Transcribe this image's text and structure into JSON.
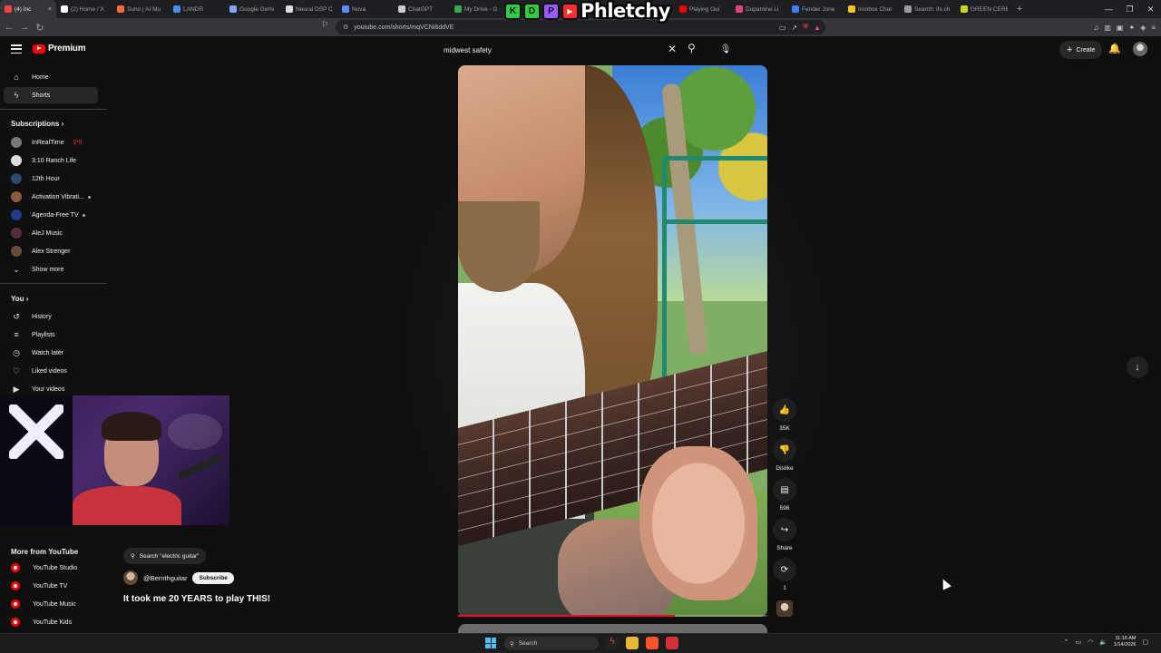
{
  "browser": {
    "tabs": [
      {
        "label": "(4) Inc",
        "color": "#ff4444",
        "active": true
      },
      {
        "label": "(2) Home / X",
        "color": "#ffffff"
      },
      {
        "label": "Suno | AI Mu",
        "color": "#ff6b3d"
      },
      {
        "label": "LANDR",
        "color": "#4a90e2"
      },
      {
        "label": "Google Gemi",
        "color": "#7aa7ff"
      },
      {
        "label": "Neural DSP C",
        "color": "#dddddd"
      },
      {
        "label": "Nova",
        "color": "#5b8cff"
      },
      {
        "label": "ChatGPT",
        "color": "#cccccc"
      },
      {
        "label": "My Drive - G",
        "color": "#34a853"
      },
      {
        "label": "",
        "color": "#34a853"
      },
      {
        "label": "",
        "color": "#999999"
      },
      {
        "label": "Boney (BETH",
        "color": "#dddddd"
      },
      {
        "label": "Playing Gui",
        "color": "#ff0000"
      },
      {
        "label": "Dopamine Li",
        "color": "#e0457b"
      },
      {
        "label": "Fender Jone",
        "color": "#3b82f6"
      },
      {
        "label": "Ironbox Char",
        "color": "#f5c518"
      },
      {
        "label": "Search: ifs ch",
        "color": "#999999"
      },
      {
        "label": "GREEN CERE",
        "color": "#c9d91a"
      }
    ],
    "close_tab_glyph": "×",
    "new_tab_glyph": "+",
    "url": "youtube.com/shorts/mqVCNi6ddVE",
    "window_controls": [
      "—",
      "❐",
      "✕"
    ]
  },
  "overlay": {
    "letters": [
      "K",
      "D",
      "P",
      ""
    ],
    "letter_colors": [
      "#2ecc40",
      "#2ecc40",
      "#9b59ff",
      "#ff2d2d"
    ],
    "brand": "Phletchy"
  },
  "header": {
    "logo_text": "Premium",
    "search_value": "midwest safety",
    "create_label": "Create"
  },
  "sidebar": {
    "main": [
      {
        "label": "Home",
        "icon": "⌂"
      },
      {
        "label": "Shorts",
        "icon": "ϟ",
        "active": true
      }
    ],
    "subscriptions_heading": "Subscriptions",
    "subscriptions": [
      {
        "label": "InRealTime",
        "color": "#777777",
        "live": true
      },
      {
        "label": "3:10 Ranch Life",
        "color": "#dddddd"
      },
      {
        "label": "12th Hour",
        "color": "#2b4a6e"
      },
      {
        "label": "Activation Vibrati...",
        "color": "#8a5a3a",
        "dot": true
      },
      {
        "label": "Agenda-Free TV",
        "color": "#1f3a8a",
        "dot": true
      },
      {
        "label": "AleJ Music",
        "color": "#5a2a3a"
      },
      {
        "label": "Alex Strenger",
        "color": "#6a4a3a"
      }
    ],
    "show_more": "Show more",
    "you_heading": "You",
    "you_items": [
      {
        "label": "History",
        "icon": "↺"
      },
      {
        "label": "Playlists",
        "icon": "≡"
      },
      {
        "label": "Watch later",
        "icon": "◷"
      },
      {
        "label": "Liked videos",
        "icon": "♡"
      },
      {
        "label": "Your videos",
        "icon": "▶"
      }
    ],
    "more_from_heading": "More from YouTube",
    "more_from": [
      {
        "label": "YouTube Studio"
      },
      {
        "label": "YouTube TV"
      },
      {
        "label": "YouTube Music"
      },
      {
        "label": "YouTube Kids"
      }
    ]
  },
  "short": {
    "search_chip": "Search \"electric guitar\"",
    "channel": "@Bernthguitar",
    "subscribe_label": "Subscribe",
    "title": "It took me 20 YEARS to play THIS!",
    "progress": 0.7
  },
  "actions": [
    {
      "name": "like-button",
      "icon": "👍",
      "label": "35K"
    },
    {
      "name": "dislike-button",
      "icon": "👎",
      "label": "Dislike"
    },
    {
      "name": "comments-button",
      "icon": "▤",
      "label": "598"
    },
    {
      "name": "share-button",
      "icon": "↪",
      "label": "Share"
    },
    {
      "name": "remix-button",
      "icon": "⟳",
      "label": "1"
    }
  ],
  "taskbar": {
    "search_label": "Search",
    "time": "11:16 AM",
    "date": "1/14/2026"
  }
}
